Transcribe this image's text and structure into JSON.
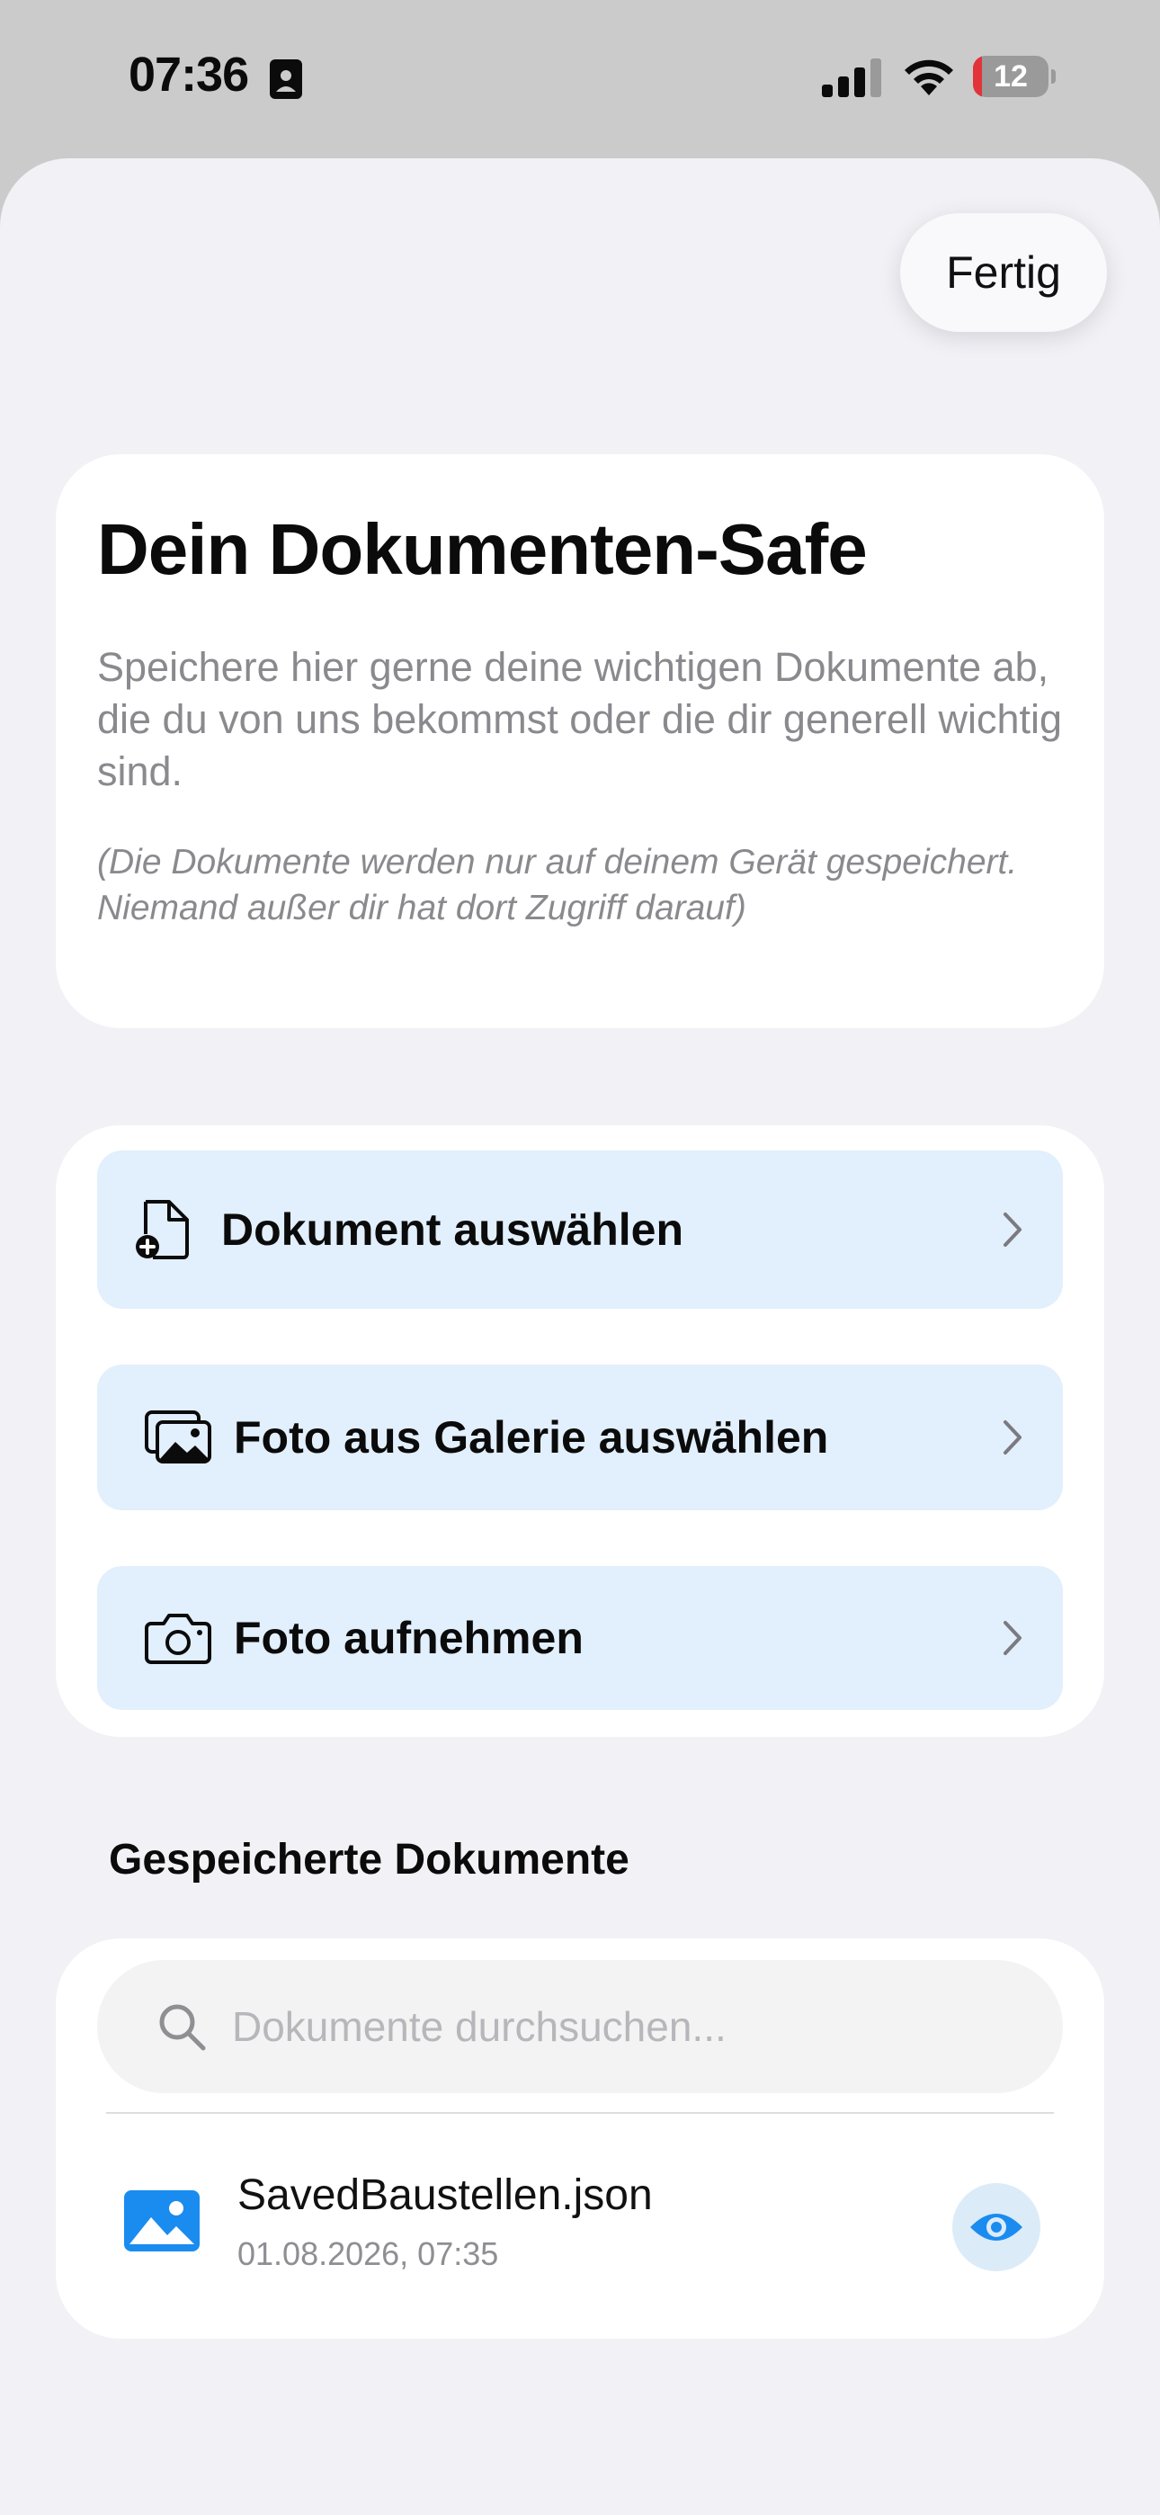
{
  "status_bar": {
    "time": "07:36",
    "battery_text": "12",
    "battery_level": 0.12,
    "battery_color": "#e2333b",
    "icons": [
      "contact-card-icon",
      "cellular-signal-icon",
      "wifi-icon",
      "battery-icon"
    ]
  },
  "header": {
    "done_label": "Fertig"
  },
  "intro": {
    "title": "Dein Dokumenten-Safe",
    "text": "Speichere hier gerne deine wichtigen Dokumente ab, die du von uns bekommst oder die dir generell wichtig sind.",
    "note": "(Die Dokumente werden nur auf deinem Gerät gespeichert. Niemand außer dir hat dort Zugriff darauf)"
  },
  "actions": [
    {
      "label": "Dokument auswählen",
      "icon": "document-add-icon"
    },
    {
      "label": "Foto aus Galerie auswählen",
      "icon": "photo-gallery-icon"
    },
    {
      "label": "Foto aufnehmen",
      "icon": "camera-icon"
    }
  ],
  "saved": {
    "section_title": "Gespeicherte Dokumente",
    "search_placeholder": "Dokumente durchsuchen...",
    "search_value": "",
    "documents": [
      {
        "name": "SavedBaustellen.json",
        "date": "01.08.2026, 07:35",
        "icon": "image-file-icon",
        "action_icon": "eye-icon"
      }
    ]
  },
  "colors": {
    "accent": "#1a8cf0",
    "action_bg": "#e2effc",
    "sheet_bg": "#f1f1f6",
    "card_bg": "#ffffff",
    "secondary_text": "#8a8a8e"
  }
}
